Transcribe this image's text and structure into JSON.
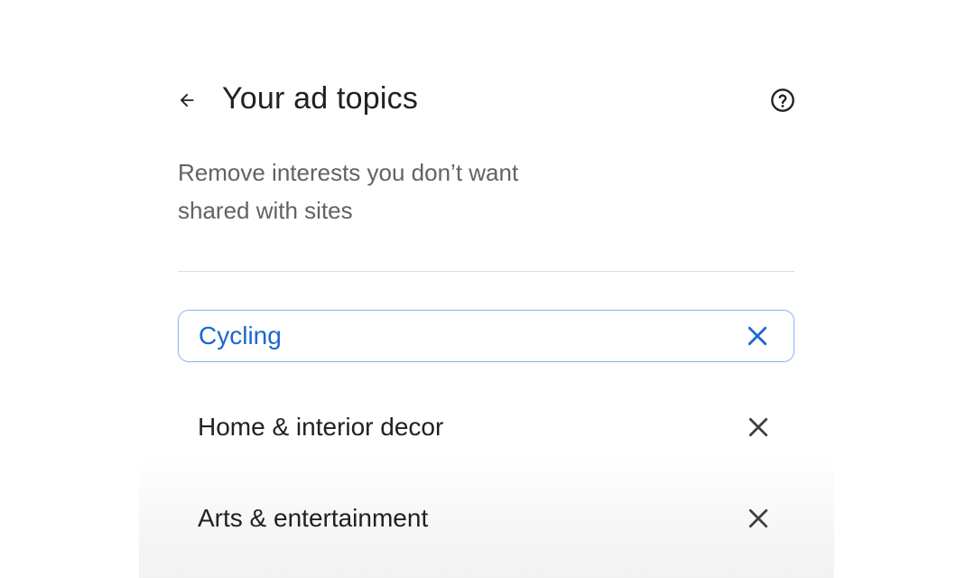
{
  "header": {
    "title": "Your ad topics",
    "back_icon": "arrow-back-icon",
    "help_icon": "help-circle-icon"
  },
  "description": {
    "line1": "Remove interests you don’t want",
    "line2": "shared with sites"
  },
  "topics": [
    {
      "label": "Cycling",
      "focused": true,
      "remove_icon": "close-icon"
    },
    {
      "label": "Home & interior decor",
      "focused": false,
      "remove_icon": "close-icon"
    },
    {
      "label": "Arts & entertainment",
      "focused": false,
      "remove_icon": "close-icon"
    }
  ],
  "colors": {
    "accent": "#1967d2",
    "focus_border": "#8ab4f8",
    "text_primary": "#202124",
    "text_secondary": "#5f6368",
    "divider": "#dadce0"
  }
}
